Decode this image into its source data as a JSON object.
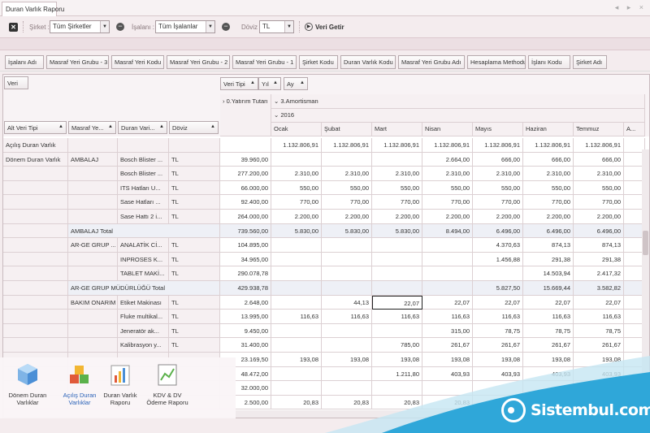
{
  "tab": {
    "title": "Duran Varlık Raporu",
    "nav": "◂ ▸ ×"
  },
  "toolbar": {
    "sirket_label": "Şirket :",
    "sirket_value": "Tüm Şirketler",
    "isalani_label": "İşalanı :",
    "isalani_value": "Tüm İşalanlar",
    "doviz_label": "Döviz",
    "doviz_value": "TL",
    "fetch_label": "Veri Getir"
  },
  "field_buttons": [
    "İşalanı Adı",
    "Masraf Yeri Grubu - 3",
    "Masraf Yeri Kodu",
    "Masraf Yeri Grubu - 2",
    "Masraf Yeri Grubu - 1",
    "Şirket Kodu",
    "Duran Varlık Kodu",
    "Masraf Yeri Grubu Adı",
    "Hesaplama Methodu",
    "İşlanı Kodu",
    "Şirket Adı"
  ],
  "pivot": {
    "data_area": "Veri",
    "col_fields": [
      "Veri Tipi",
      "Yıl",
      "Ay"
    ],
    "row_fields": [
      "Alt Veri Tipi",
      "Masraf Ye...",
      "Duran Vari...",
      "Döviz"
    ],
    "col_header_1": "0.Yatırım Tutarı",
    "col_header_2": "3.Amortisman",
    "col_header_3": "2016",
    "months": [
      "Ocak",
      "Şubat",
      "Mart",
      "Nisan",
      "Mayıs",
      "Haziran",
      "Temmuz",
      "A..."
    ],
    "rows": [
      {
        "l1": "Açılış Duran Varlık",
        "l2": "",
        "l3": "",
        "cur": "",
        "type": "group",
        "vals": [
          "",
          "1.132.806,91",
          "1.132.806,91",
          "1.132.806,91",
          "1.132.806,91",
          "1.132.806,91",
          "1.132.806,91",
          "1.132.806,91",
          ""
        ]
      },
      {
        "l1": "Dönem Duran Varlık",
        "l2": "AMBALAJ",
        "l3": "Bosch Blister ...",
        "cur": "TL",
        "type": "data",
        "vals": [
          "39.960,00",
          "",
          "",
          "",
          "2.664,00",
          "666,00",
          "666,00",
          "666,00",
          ""
        ]
      },
      {
        "l1": "",
        "l2": "",
        "l3": "Bosch Blister ...",
        "cur": "TL",
        "type": "data",
        "vals": [
          "277.200,00",
          "2.310,00",
          "2.310,00",
          "2.310,00",
          "2.310,00",
          "2.310,00",
          "2.310,00",
          "2.310,00",
          ""
        ]
      },
      {
        "l1": "",
        "l2": "",
        "l3": "ITS Hatları U...",
        "cur": "TL",
        "type": "data",
        "vals": [
          "66.000,00",
          "550,00",
          "550,00",
          "550,00",
          "550,00",
          "550,00",
          "550,00",
          "550,00",
          ""
        ]
      },
      {
        "l1": "",
        "l2": "",
        "l3": "Sase Hatları ...",
        "cur": "TL",
        "type": "data",
        "vals": [
          "92.400,00",
          "770,00",
          "770,00",
          "770,00",
          "770,00",
          "770,00",
          "770,00",
          "770,00",
          ""
        ]
      },
      {
        "l1": "",
        "l2": "",
        "l3": "Sase Hattı 2 i...",
        "cur": "TL",
        "type": "data",
        "vals": [
          "264.000,00",
          "2.200,00",
          "2.200,00",
          "2.200,00",
          "2.200,00",
          "2.200,00",
          "2.200,00",
          "2.200,00",
          ""
        ]
      },
      {
        "l1": "",
        "l2": "AMBALAJ Total",
        "l3": "",
        "cur": "",
        "type": "total",
        "vals": [
          "739.560,00",
          "5.830,00",
          "5.830,00",
          "5.830,00",
          "8.494,00",
          "6.496,00",
          "6.496,00",
          "6.496,00",
          ""
        ]
      },
      {
        "l1": "",
        "l2": "AR-GE GRUP ...",
        "l3": "ANALATİK Cİ...",
        "cur": "TL",
        "type": "data",
        "vals": [
          "104.895,00",
          "",
          "",
          "",
          "",
          "4.370,63",
          "874,13",
          "874,13",
          ""
        ]
      },
      {
        "l1": "",
        "l2": "",
        "l3": "INPROSES K...",
        "cur": "TL",
        "type": "data",
        "vals": [
          "34.965,00",
          "",
          "",
          "",
          "",
          "1.456,88",
          "291,38",
          "291,38",
          ""
        ]
      },
      {
        "l1": "",
        "l2": "",
        "l3": "TABLET MAKİ...",
        "cur": "TL",
        "type": "data",
        "vals": [
          "290.078,78",
          "",
          "",
          "",
          "",
          "",
          "14.503,94",
          "2.417,32",
          ""
        ]
      },
      {
        "l1": "",
        "l2": "AR-GE GRUP MÜDÜRLÜĞÜ Total",
        "l3": "",
        "cur": "",
        "type": "total",
        "vals": [
          "429.938,78",
          "",
          "",
          "",
          "",
          "5.827,50",
          "15.669,44",
          "3.582,82",
          ""
        ]
      },
      {
        "l1": "",
        "l2": "BAKIM ONARIM",
        "l3": "Etiket Makinası",
        "cur": "TL",
        "type": "data",
        "vals": [
          "2.648,00",
          "",
          "44,13",
          "22,07",
          "22,07",
          "22,07",
          "22,07",
          "22,07",
          ""
        ]
      },
      {
        "l1": "",
        "l2": "",
        "l3": "Fluke multikal...",
        "cur": "TL",
        "type": "data",
        "vals": [
          "13.995,00",
          "116,63",
          "116,63",
          "116,63",
          "116,63",
          "116,63",
          "116,63",
          "116,63",
          ""
        ]
      },
      {
        "l1": "",
        "l2": "",
        "l3": "Jeneratör ak...",
        "cur": "TL",
        "type": "data",
        "vals": [
          "9.450,00",
          "",
          "",
          "",
          "315,00",
          "78,75",
          "78,75",
          "78,75",
          ""
        ]
      },
      {
        "l1": "",
        "l2": "",
        "l3": "Kalibrasyon y...",
        "cur": "TL",
        "type": "data",
        "vals": [
          "31.400,00",
          "",
          "",
          "785,00",
          "261,67",
          "261,67",
          "261,67",
          "261,67",
          ""
        ]
      },
      {
        "l1": "",
        "l2": "",
        "l3": "",
        "cur": "",
        "type": "data",
        "vals": [
          "23.169,50",
          "193,08",
          "193,08",
          "193,08",
          "193,08",
          "193,08",
          "193,08",
          "193,08",
          ""
        ]
      },
      {
        "l1": "",
        "l2": "",
        "l3": "",
        "cur": "",
        "type": "data",
        "vals": [
          "48.472,00",
          "",
          "",
          "1.211,80",
          "403,93",
          "403,93",
          "403,93",
          "403,93",
          ""
        ]
      },
      {
        "l1": "",
        "l2": "",
        "l3": "",
        "cur": "",
        "type": "data",
        "vals": [
          "32.000,00",
          "",
          "",
          "",
          "",
          "",
          "",
          "",
          ""
        ]
      },
      {
        "l1": "",
        "l2": "",
        "l3": "",
        "cur": "",
        "type": "data",
        "vals": [
          "2.500,00",
          "20,83",
          "20,83",
          "20,83",
          "20,83",
          "20,83",
          "20,83",
          "20,83",
          ""
        ]
      }
    ]
  },
  "launcher": [
    {
      "label": "Dönem Duran Varlıklar",
      "icon": "cube-blue-icon",
      "active": false
    },
    {
      "label": "Açılış Duran Varlıklar",
      "icon": "cubes-color-icon",
      "active": true
    },
    {
      "label": "Duran Varlık Raporu",
      "icon": "bar-chart-icon",
      "active": false
    },
    {
      "label": "KDV & DV Ödeme Raporu",
      "icon": "report-chart-icon",
      "active": false
    }
  ],
  "brand": {
    "name": "Sistembul.com"
  },
  "colors": {
    "accent": "#2fa7d9",
    "selected": "#2a62b8"
  }
}
